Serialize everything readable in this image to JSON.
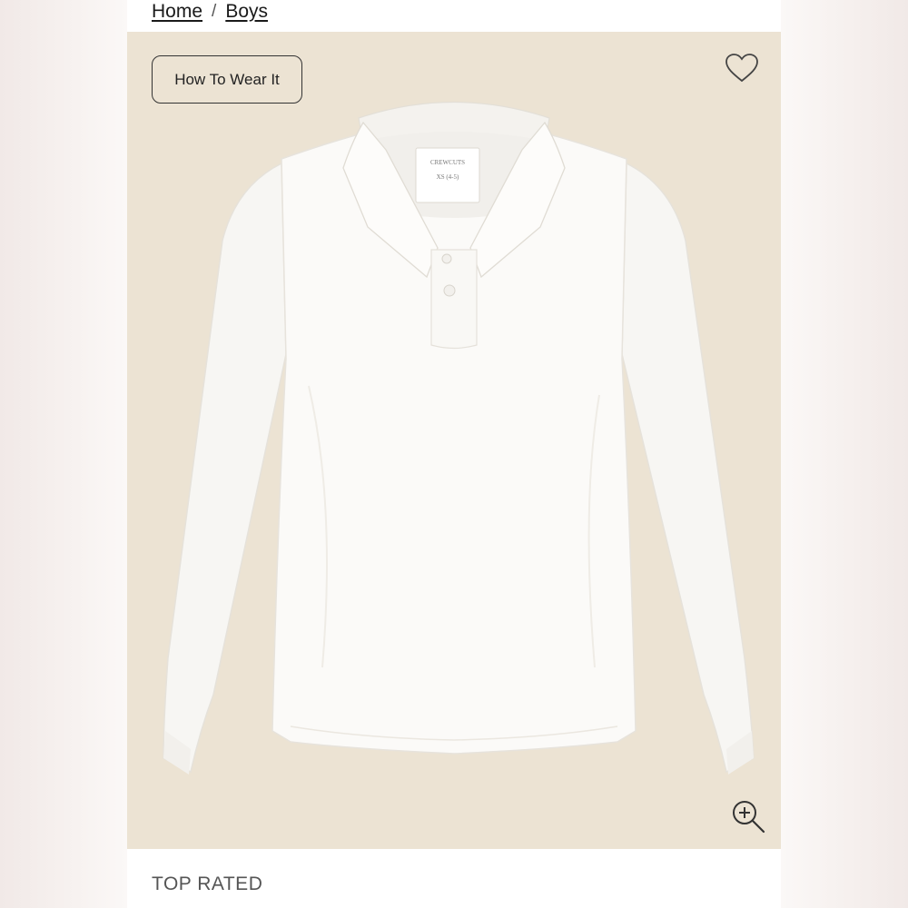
{
  "breadcrumb": {
    "items": [
      {
        "label": "Home"
      },
      {
        "label": "Boys"
      }
    ],
    "separator": "/"
  },
  "product": {
    "how_to_wear_label": "How To Wear It",
    "label_text": {
      "brand": "CREWCUTS",
      "size": "XS (4-5)"
    },
    "background_color": "#ece3d3"
  },
  "icons": {
    "favorite": "heart-icon",
    "zoom": "zoom-in-icon"
  },
  "section": {
    "top_rated_label": "TOP RATED"
  }
}
